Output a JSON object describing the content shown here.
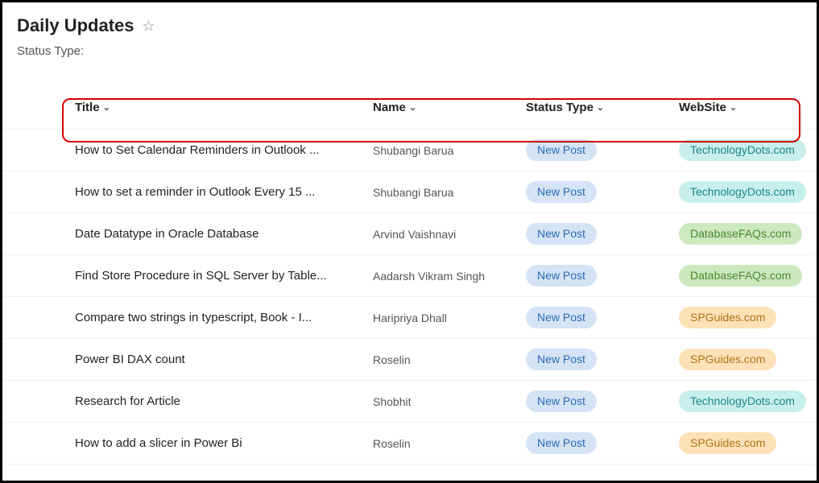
{
  "header": {
    "title": "Daily Updates"
  },
  "filter": {
    "label": "Status Type:"
  },
  "columns": {
    "title": "Title",
    "name": "Name",
    "status": "Status Type",
    "website": "WebSite"
  },
  "website_styles": {
    "TechnologyDots.com": "pill-cyan",
    "DatabaseFAQs.com": "pill-green",
    "SPGuides.com": "pill-yellow"
  },
  "rows": [
    {
      "title": "How to Set Calendar Reminders in Outlook ...",
      "name": "Shubangi Barua",
      "status": "New Post",
      "website": "TechnologyDots.com"
    },
    {
      "title": "How to set a reminder in Outlook Every 15 ...",
      "name": "Shubangi Barua",
      "status": "New Post",
      "website": "TechnologyDots.com"
    },
    {
      "title": "Date Datatype in Oracle Database",
      "name": "Arvind Vaishnavi",
      "status": "New Post",
      "website": "DatabaseFAQs.com"
    },
    {
      "title": "Find Store Procedure in SQL Server by Table...",
      "name": "Aadarsh Vikram Singh",
      "status": "New Post",
      "website": "DatabaseFAQs.com"
    },
    {
      "title": "Compare two strings in typescript, Book - I...",
      "name": "Haripriya Dhall",
      "status": "New Post",
      "website": "SPGuides.com"
    },
    {
      "title": "Power BI DAX count",
      "name": "Roselin",
      "status": "New Post",
      "website": "SPGuides.com"
    },
    {
      "title": "Research for Article",
      "name": "Shobhit",
      "status": "New Post",
      "website": "TechnologyDots.com"
    },
    {
      "title": "How to add a slicer in Power Bi",
      "name": "Roselin",
      "status": "New Post",
      "website": "SPGuides.com"
    }
  ]
}
